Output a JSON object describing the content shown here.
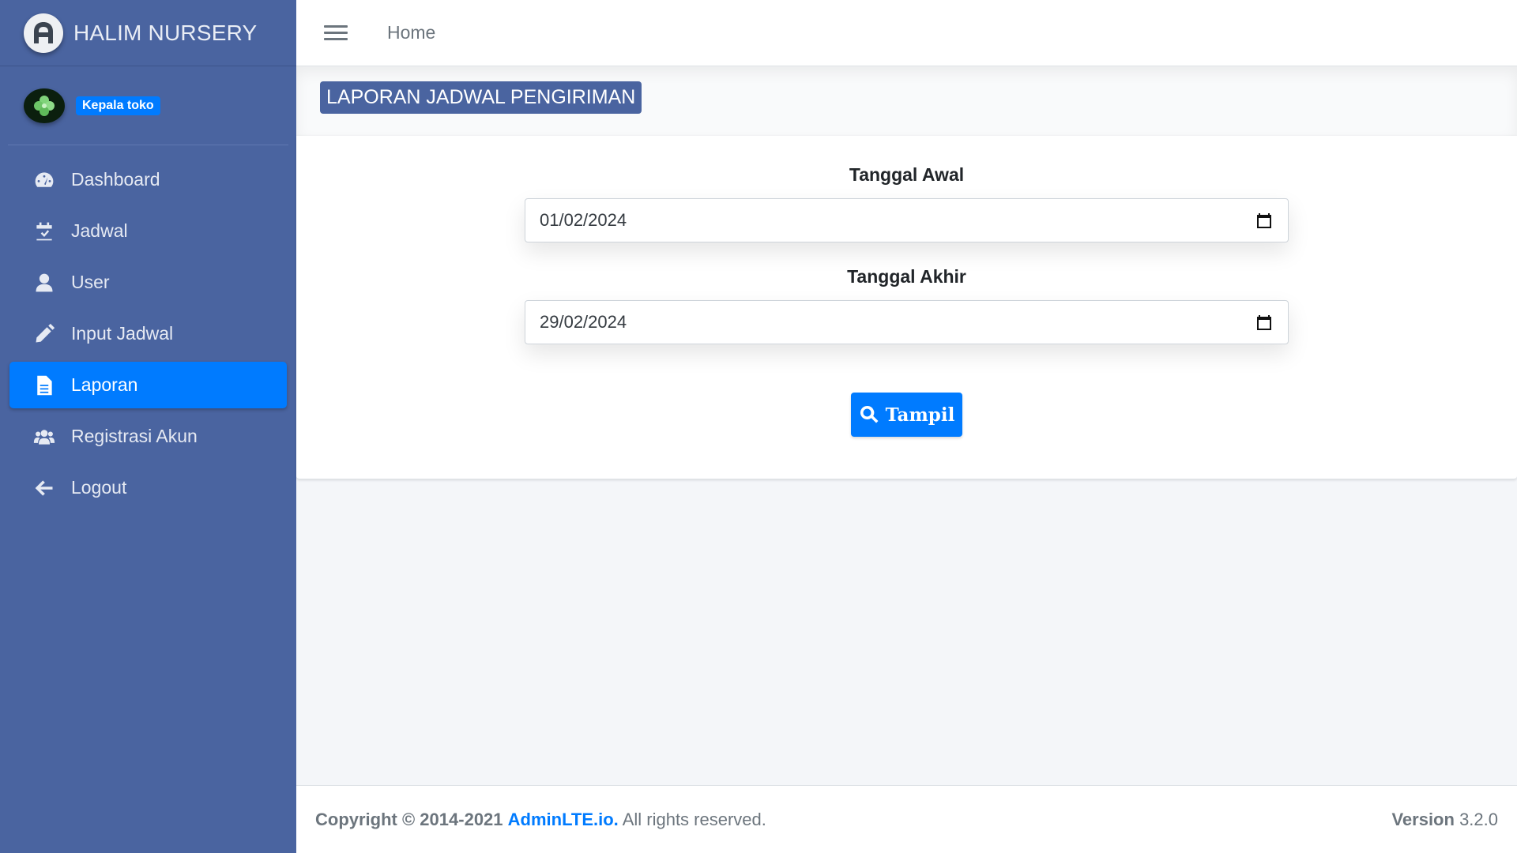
{
  "brand": {
    "name": "HALIM NURSERY",
    "logo_icon": "adminlte-logo-icon"
  },
  "user": {
    "role_badge": "Kepala toko",
    "avatar_icon": "clover-avatar-icon"
  },
  "sidebar": {
    "items": [
      {
        "label": "Dashboard",
        "icon": "tachometer-icon",
        "active": false
      },
      {
        "label": "Jadwal",
        "icon": "calendar-check-icon",
        "active": false
      },
      {
        "label": "User",
        "icon": "user-icon",
        "active": false
      },
      {
        "label": "Input Jadwal",
        "icon": "pencil-icon",
        "active": false
      },
      {
        "label": "Laporan",
        "icon": "file-alt-icon",
        "active": true
      },
      {
        "label": "Registrasi Akun",
        "icon": "users-icon",
        "active": false
      },
      {
        "label": "Logout",
        "icon": "arrow-left-icon",
        "active": false
      }
    ]
  },
  "topbar": {
    "home_label": "Home"
  },
  "page": {
    "title": "LAPORAN JADWAL PENGIRIMAN"
  },
  "form": {
    "start_label": "Tanggal Awal",
    "start_value": "01/02/2024",
    "end_label": "Tanggal Akhir",
    "end_value": "29/02/2024",
    "submit_label": "Tampil"
  },
  "footer": {
    "copyright": "Copyright © 2014-2021",
    "link": "AdminLTE.io.",
    "rights": "All rights reserved.",
    "version_label": "Version",
    "version_number": "3.2.0"
  },
  "colors": {
    "sidebar": "#4a64a0",
    "accent": "#007bff",
    "background": "#f4f6f9"
  }
}
